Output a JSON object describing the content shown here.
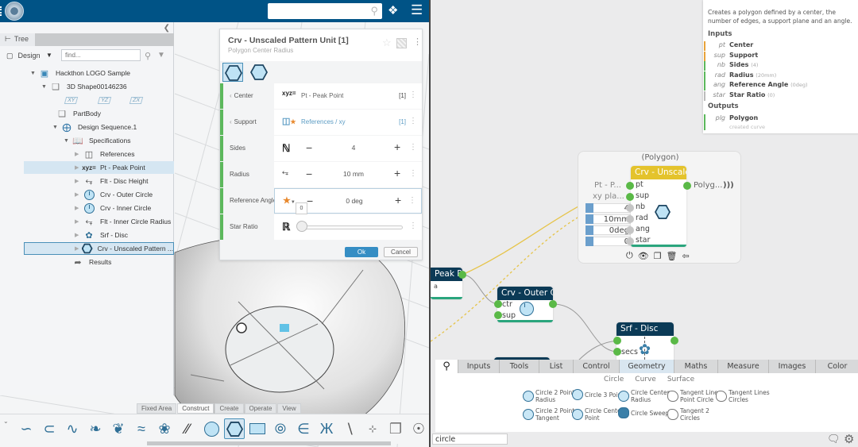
{
  "topbar": {
    "search_placeholder": "",
    "search_icon": "search-icon",
    "tag_icon": "tag-icon",
    "menu_icon": "hamburger-icon"
  },
  "tree": {
    "tab_label": "Tree",
    "design_label": "Design",
    "find_placeholder": "find...",
    "items": [
      {
        "label": "Hackthon LOGO Sample",
        "icon": "product-icon",
        "expanded": true
      },
      {
        "label": "3D Shape00146236",
        "icon": "shape-icon",
        "expanded": true
      },
      {
        "label": "PartBody",
        "icon": "body-icon"
      },
      {
        "label": "Design Sequence.1",
        "icon": "design-sequence-icon",
        "expanded": true
      },
      {
        "label": "Specifications",
        "icon": "book-icon",
        "expanded": true
      },
      {
        "label": "References",
        "icon": "references-icon"
      },
      {
        "label": "Pt - Peak Point",
        "icon": "point-icon",
        "selected": true
      },
      {
        "label": "Flt - Disc Height",
        "icon": "length-icon"
      },
      {
        "label": "Crv - Outer Circle",
        "icon": "circle-icon"
      },
      {
        "label": "Crv - Inner Circle",
        "icon": "circle-icon"
      },
      {
        "label": "Flt - Inner Circle Radius",
        "icon": "length-icon"
      },
      {
        "label": "Srf - Disc",
        "icon": "surface-icon"
      },
      {
        "label": "Crv - Unscaled Pattern ...",
        "icon": "polygon-icon",
        "current": true
      },
      {
        "label": "Results",
        "icon": "results-icon"
      }
    ],
    "planes": [
      "XY",
      "YZ",
      "ZX"
    ]
  },
  "edit_panel": {
    "title": "Crv - Unscaled Pattern Unit [1]",
    "subtitle": "Polygon Center Radius",
    "rows": [
      {
        "label": "Center",
        "value": "Pt - Peak Point",
        "count": "[1]"
      },
      {
        "label": "Support",
        "value": "References / xy",
        "count": "[1]"
      },
      {
        "label": "Sides",
        "value": "4"
      },
      {
        "label": "Radius",
        "value": "10 mm"
      },
      {
        "label": "Reference Angle",
        "value": "0 deg"
      },
      {
        "label": "Star Ratio",
        "value": "0"
      }
    ],
    "star_ratio_fraction": 0,
    "slider_tooltip": "0",
    "ok_label": "Ok",
    "cancel_label": "Cancel"
  },
  "bottom_toolbar": {
    "tabs": [
      "Fixed Area",
      "Construct",
      "Create",
      "Operate",
      "View"
    ],
    "active_tab": "Construct",
    "icons": [
      "spline-icon",
      "connect-curve-icon",
      "wave-curve-icon",
      "sweep-icon",
      "blend-icon",
      "multi-sweep-icon",
      "twist-icon",
      "parallel-curves-icon",
      "circle-icon",
      "polygon-icon",
      "rectangle-icon",
      "ellipse-icon",
      "helix-icon",
      "spiral-icon",
      "line-icon",
      "point-icon",
      "box-icon",
      "center-circle-icon"
    ]
  },
  "graph": {
    "group_title": "(Polygon)",
    "polygon_node": {
      "title": "Crv - Unscaled Pattern Unit",
      "inputs": [
        "pt",
        "sup",
        "nb",
        "rad",
        "ang",
        "star"
      ],
      "input_sources": {
        "pt": "Pt - P...",
        "sup": "xy pla..."
      },
      "input_values": {
        "nb": "4",
        "rad": "10mm",
        "ang": "0deg",
        "star": "0"
      },
      "output": "Polyg..."
    },
    "peak_node": {
      "title": "Peak Point",
      "port": "a"
    },
    "outer_node": {
      "title": "Crv - Outer Circle",
      "inputs": [
        "ctr",
        "sup"
      ]
    },
    "disc_node": {
      "title": "Srf - Disc",
      "inputs": [
        "",
        "secs"
      ]
    }
  },
  "info_panel": {
    "description": "Creates a polygon defined by a center, the number of edges, a support plane and an angle.",
    "inputs_header": "Inputs",
    "inputs": [
      {
        "abbr": "pt",
        "name": "Center",
        "default": "",
        "color": "#e8a33a"
      },
      {
        "abbr": "sup",
        "name": "Support",
        "default": "",
        "color": "#e8a33a"
      },
      {
        "abbr": "nb",
        "name": "Sides",
        "default": "(4)",
        "color": "#5cb85c"
      },
      {
        "abbr": "rad",
        "name": "Radius",
        "default": "(20mm)",
        "color": "#5cb85c"
      },
      {
        "abbr": "ang",
        "name": "Reference Angle",
        "default": "(0deg)",
        "color": "#5cb85c"
      },
      {
        "abbr": "star",
        "name": "Star Ratio",
        "default": "(0)",
        "color": "#bbbbbb"
      }
    ],
    "outputs_header": "Outputs",
    "outputs": [
      {
        "abbr": "plg",
        "name": "Polygon",
        "desc": "created curve",
        "color": "#5cb85c"
      }
    ]
  },
  "library": {
    "tabs": [
      "Inputs",
      "Tools",
      "List",
      "Control",
      "Geometry",
      "Maths",
      "Measure",
      "Images",
      "Color"
    ],
    "active_tab": "Geometry",
    "subtabs": [
      "Circle",
      "Curve",
      "Surface"
    ],
    "items": [
      {
        "label1": "Circle 2 Points",
        "label2": "Radius"
      },
      {
        "label1": "Circle 3 Points",
        "label2": ""
      },
      {
        "label1": "Circle Center",
        "label2": "Radius"
      },
      {
        "label1": "Tangent Lines",
        "label2": "Point Circle"
      },
      {
        "label1": "Tangent Lines",
        "label2": "Circles"
      },
      {
        "label1": "Circle 2 Points",
        "label2": "Tangent"
      },
      {
        "label1": "Circle Center",
        "label2": "Point"
      },
      {
        "label1": "Circle Sweep",
        "label2": ""
      },
      {
        "label1": "Tangent 2",
        "label2": "Circles"
      }
    ],
    "search_value": "circle"
  },
  "colors": {
    "topbar": "#005386",
    "node_header": "#0b3a56",
    "active_node": "#e4c32c",
    "port": "#5ab947",
    "accent": "#368ec4"
  }
}
